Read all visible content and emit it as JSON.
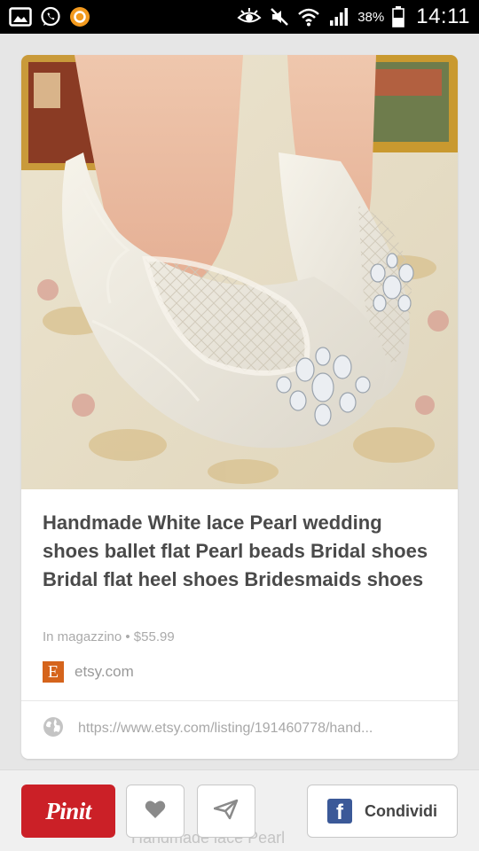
{
  "status_bar": {
    "battery": "38%",
    "time": "14:11",
    "left_icons": [
      "gallery-icon",
      "whatsapp-icon",
      "orange-app-icon"
    ],
    "right_icons": [
      "eye-icon",
      "muted-icon",
      "wifi-icon",
      "signal-icon",
      "battery-icon"
    ]
  },
  "pin": {
    "title": "Handmade White lace Pearl wedding shoes ballet flat Pearl beads Bridal shoes Bridal flat heel shoes Bridesmaids shoes",
    "meta": "In magazzino • $55.99",
    "source": {
      "logo_letter": "E",
      "name": "etsy.com",
      "logo_color": "#d5641c"
    },
    "link": "https://www.etsy.com/listing/191460778/hand..."
  },
  "action_bar": {
    "pin_label": "Pinit",
    "share_label": "Condividi",
    "ghost_text": "Handmade lace Pearl",
    "pin_color": "#cb2027",
    "facebook_color": "#3b5998"
  }
}
